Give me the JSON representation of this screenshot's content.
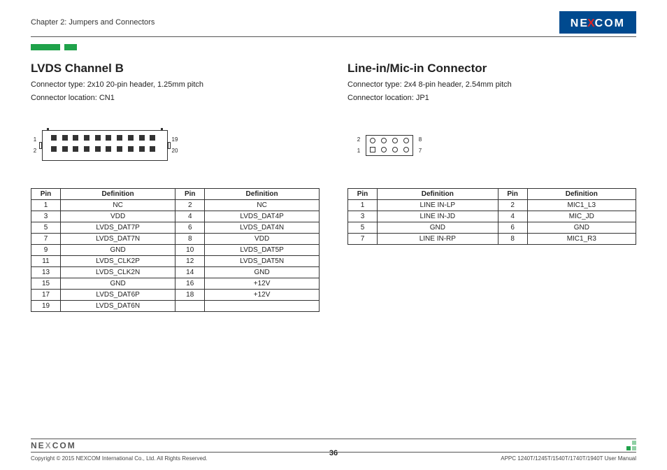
{
  "header": {
    "chapter": "Chapter 2: Jumpers and Connectors",
    "brand_pre": "NE",
    "brand_x": "X",
    "brand_post": "COM"
  },
  "lvds": {
    "title": "LVDS Channel B",
    "sub1": "Connector type: 2x10 20-pin header, 1.25mm pitch",
    "sub2": "Connector location: CN1",
    "pinlabels": {
      "tl": "1",
      "bl": "2",
      "tr": "19",
      "br": "20"
    },
    "table_headers": {
      "pin": "Pin",
      "def": "Definition"
    },
    "rows": [
      {
        "p1": "1",
        "d1": "NC",
        "p2": "2",
        "d2": "NC"
      },
      {
        "p1": "3",
        "d1": "VDD",
        "p2": "4",
        "d2": "LVDS_DAT4P"
      },
      {
        "p1": "5",
        "d1": "LVDS_DAT7P",
        "p2": "6",
        "d2": "LVDS_DAT4N"
      },
      {
        "p1": "7",
        "d1": "LVDS_DAT7N",
        "p2": "8",
        "d2": "VDD"
      },
      {
        "p1": "9",
        "d1": "GND",
        "p2": "10",
        "d2": "LVDS_DAT5P"
      },
      {
        "p1": "11",
        "d1": "LVDS_CLK2P",
        "p2": "12",
        "d2": "LVDS_DAT5N"
      },
      {
        "p1": "13",
        "d1": "LVDS_CLK2N",
        "p2": "14",
        "d2": "GND"
      },
      {
        "p1": "15",
        "d1": "GND",
        "p2": "16",
        "d2": "+12V"
      },
      {
        "p1": "17",
        "d1": "LVDS_DAT6P",
        "p2": "18",
        "d2": "+12V"
      },
      {
        "p1": "19",
        "d1": "LVDS_DAT6N",
        "p2": "",
        "d2": ""
      }
    ]
  },
  "linein": {
    "title": "Line-in/Mic-in Connector",
    "sub1": "Connector type: 2x4 8-pin header, 2.54mm pitch",
    "sub2": "Connector location: JP1",
    "pinlabels": {
      "tl": "2",
      "bl": "1",
      "tr": "8",
      "br": "7"
    },
    "table_headers": {
      "pin": "Pin",
      "def": "Definition"
    },
    "rows": [
      {
        "p1": "1",
        "d1": "LINE IN-LP",
        "p2": "2",
        "d2": "MIC1_L3"
      },
      {
        "p1": "3",
        "d1": "LINE IN-JD",
        "p2": "4",
        "d2": "MIC_JD"
      },
      {
        "p1": "5",
        "d1": "GND",
        "p2": "6",
        "d2": "GND"
      },
      {
        "p1": "7",
        "d1": "LINE IN-RP",
        "p2": "8",
        "d2": "MIC1_R3"
      }
    ]
  },
  "footer": {
    "copyright": "Copyright © 2015 NEXCOM International Co., Ltd. All Rights Reserved.",
    "page": "36",
    "doc": "APPC 1240T/1245T/1540T/1740T/1940T User Manual"
  }
}
